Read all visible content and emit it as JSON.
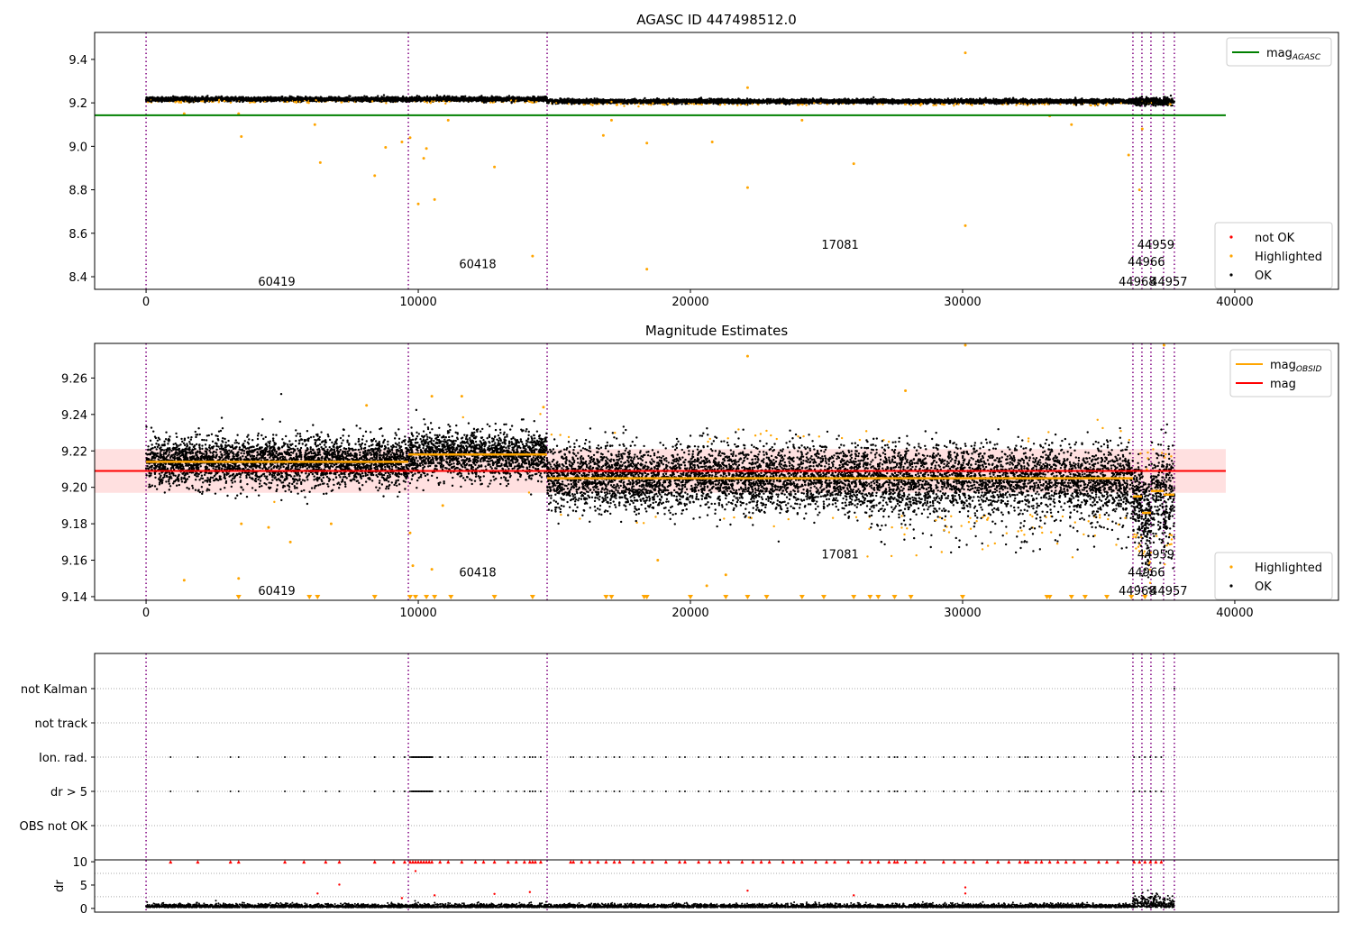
{
  "chart_data": [
    {
      "type": "scatter",
      "title": "AGASC ID 447498512.0",
      "xlim": [
        -1890,
        43810
      ],
      "ylim": [
        8.342,
        9.524
      ],
      "xticks": [
        0,
        10000,
        20000,
        30000,
        40000
      ],
      "yticks": [
        8.4,
        8.6,
        8.8,
        9.0,
        9.2,
        9.4
      ],
      "ytick_labels": [
        "8.4",
        "8.6",
        "8.8",
        "9.0",
        "9.2",
        "9.4"
      ],
      "legend_upper": {
        "placement": "upper right",
        "entries": [
          {
            "label": "mag",
            "subscript": "AGASC",
            "color": "#008000",
            "kind": "line"
          }
        ]
      },
      "legend_lower": {
        "placement": "lower right",
        "entries": [
          {
            "label": "not OK",
            "color": "#ff0000",
            "kind": "dot"
          },
          {
            "label": "Highlighted",
            "color": "#ffa500",
            "kind": "dot"
          },
          {
            "label": "OK",
            "color": "#000000",
            "kind": "dot"
          }
        ]
      },
      "mag_agasc": {
        "value": 9.143,
        "x_range": [
          0,
          39670
        ],
        "color": "#008000"
      },
      "ok_points_summary": {
        "level_before_14735": 9.217,
        "level_after_14735": 9.207,
        "spread": 0.008
      },
      "highlighted_points": [
        [
          3500,
          9.045
        ],
        [
          6200,
          9.1
        ],
        [
          6400,
          8.925
        ],
        [
          8400,
          8.865
        ],
        [
          8800,
          8.995
        ],
        [
          9400,
          9.02
        ],
        [
          9700,
          9.04
        ],
        [
          10000,
          8.735
        ],
        [
          10300,
          8.99
        ],
        [
          10600,
          8.755
        ],
        [
          10200,
          8.945
        ],
        [
          12800,
          8.905
        ],
        [
          14200,
          8.495
        ],
        [
          16800,
          9.05
        ],
        [
          18400,
          9.015
        ],
        [
          18400,
          8.435
        ],
        [
          20800,
          9.02
        ],
        [
          22100,
          8.81
        ],
        [
          22100,
          9.27
        ],
        [
          26000,
          8.92
        ],
        [
          30100,
          8.635
        ],
        [
          30100,
          9.43
        ],
        [
          36100,
          8.96
        ],
        [
          36500,
          8.8
        ],
        [
          1400,
          9.15
        ],
        [
          3400,
          9.15
        ],
        [
          11100,
          9.12
        ],
        [
          17100,
          9.12
        ],
        [
          24100,
          9.12
        ],
        [
          33200,
          9.14
        ],
        [
          34000,
          9.1
        ],
        [
          36600,
          9.08
        ]
      ],
      "obsid_labels": [
        {
          "text": "60419",
          "x": 4800,
          "y": 8.38
        },
        {
          "text": "60418",
          "x": 12185,
          "y": 8.46
        },
        {
          "text": "17081",
          "x": 25500,
          "y": 8.55
        },
        {
          "text": "44959",
          "x": 37100,
          "y": 8.55
        },
        {
          "text": "44966",
          "x": 36750,
          "y": 8.47
        },
        {
          "text": "44968",
          "x": 36420,
          "y": 8.38
        },
        {
          "text": "44957",
          "x": 37580,
          "y": 8.38
        }
      ]
    },
    {
      "type": "scatter",
      "title": "Magnitude Estimates",
      "xlim": [
        -1890,
        43810
      ],
      "ylim": [
        9.138,
        9.279
      ],
      "xticks": [
        0,
        10000,
        20000,
        30000,
        40000
      ],
      "yticks": [
        9.14,
        9.16,
        9.18,
        9.2,
        9.22,
        9.24,
        9.26
      ],
      "ytick_labels": [
        "9.14",
        "9.16",
        "9.18",
        "9.20",
        "9.22",
        "9.24",
        "9.26"
      ],
      "legend_upper": {
        "placement": "upper right",
        "entries": [
          {
            "label": "mag",
            "subscript": "OBSID",
            "color": "#ffa500",
            "kind": "line"
          },
          {
            "label": "mag",
            "subscript": "",
            "color": "#ff0000",
            "kind": "line"
          }
        ]
      },
      "legend_lower": {
        "placement": "lower right",
        "entries": [
          {
            "label": "Highlighted",
            "color": "#ffa500",
            "kind": "dot"
          },
          {
            "label": "OK",
            "color": "#000000",
            "kind": "dot"
          }
        ]
      },
      "mag": {
        "value": 9.209,
        "band": [
          9.197,
          9.221
        ],
        "x_range": [
          0,
          39670
        ],
        "color": "#ff0000"
      },
      "mag_obsid": [
        {
          "x0": 0,
          "x1": 9636,
          "y": 9.214,
          "sd": 0.009
        },
        {
          "x0": 9636,
          "x1": 14735,
          "y": 9.218,
          "sd": 0.009
        },
        {
          "x0": 14735,
          "x1": 36258,
          "y": 9.205,
          "sd": 0.012
        },
        {
          "x0": 36258,
          "x1": 36589,
          "y": 9.195,
          "sd": 0.014
        },
        {
          "x0": 36589,
          "x1": 36920,
          "y": 9.186,
          "sd": 0.016
        },
        {
          "x0": 36920,
          "x1": 37384,
          "y": 9.198,
          "sd": 0.016
        },
        {
          "x0": 37384,
          "x1": 37781,
          "y": 9.196,
          "sd": 0.018
        }
      ],
      "highlighted_points": [
        [
          1400,
          9.149
        ],
        [
          3400,
          9.15
        ],
        [
          3500,
          9.18
        ],
        [
          4500,
          9.178
        ],
        [
          5300,
          9.17
        ],
        [
          6800,
          9.18
        ],
        [
          9800,
          9.157
        ],
        [
          9700,
          9.175
        ],
        [
          10500,
          9.155
        ],
        [
          10900,
          9.19
        ],
        [
          18800,
          9.16
        ],
        [
          20600,
          9.146
        ],
        [
          21300,
          9.152
        ],
        [
          22100,
          9.272
        ],
        [
          27900,
          9.253
        ],
        [
          30100,
          9.278
        ],
        [
          37400,
          9.278
        ],
        [
          8100,
          9.245
        ],
        [
          10500,
          9.25
        ],
        [
          11600,
          9.25
        ],
        [
          14600,
          9.244
        ]
      ],
      "clipped_low_x": [
        3400,
        6000,
        6300,
        8400,
        9700,
        9900,
        10300,
        10600,
        11200,
        12800,
        14200,
        16900,
        17100,
        18300,
        18400,
        20000,
        21300,
        22100,
        22800,
        24100,
        24900,
        26000,
        26600,
        26900,
        27500,
        28100,
        30000,
        33100,
        33200,
        34000,
        34500,
        35300,
        36200,
        36700
      ],
      "obsid_labels": [
        {
          "text": "60419",
          "x": 4800,
          "y": 9.1435
        },
        {
          "text": "60418",
          "x": 12185,
          "y": 9.1535
        },
        {
          "text": "17081",
          "x": 25500,
          "y": 9.1635
        },
        {
          "text": "44959",
          "x": 37100,
          "y": 9.1635
        },
        {
          "text": "44966",
          "x": 36750,
          "y": 9.1535
        },
        {
          "text": "44968",
          "x": 36420,
          "y": 9.1435
        },
        {
          "text": "44957",
          "x": 37580,
          "y": 9.1435
        }
      ]
    },
    {
      "type": "scatter",
      "xlim": [
        -1890,
        43810
      ],
      "categories": [
        "not Kalman",
        "not track",
        "Ion. rad.",
        "dr > 5",
        "OBS not OK"
      ],
      "flag_times": [
        900,
        1900,
        3100,
        3400,
        5100,
        5800,
        6600,
        7100,
        8400,
        9100,
        9500,
        9700,
        9800,
        9900,
        10000,
        10100,
        10200,
        10300,
        10400,
        10500,
        10800,
        11100,
        11600,
        12100,
        12400,
        12800,
        13300,
        13600,
        13900,
        14100,
        14200,
        14300,
        14500,
        15600,
        15700,
        16000,
        16300,
        16600,
        16900,
        17200,
        17400,
        17900,
        18300,
        18600,
        19100,
        19600,
        19800,
        20300,
        20700,
        21100,
        21400,
        21900,
        22300,
        22600,
        22900,
        23400,
        23800,
        24100,
        24600,
        25000,
        25300,
        25800,
        26300,
        26600,
        26900,
        27300,
        27500,
        27600,
        27900,
        28300,
        28600,
        29300,
        29700,
        30100,
        30400,
        30900,
        31300,
        31700,
        32100,
        32300,
        32400,
        32700,
        32900,
        33200,
        33500,
        33800,
        34100,
        34500,
        35000,
        35300,
        35700,
        36300,
        36500,
        36700,
        36900,
        37100,
        37300
      ],
      "dr_panel": {
        "ylabel": "dr",
        "ylim": [
          -0.8,
          10.4
        ],
        "yticks": [
          0,
          5,
          10
        ],
        "clip_value": 10,
        "outliers": [
          [
            6300,
            3.2
          ],
          [
            7100,
            5.1
          ],
          [
            9900,
            8
          ],
          [
            10600,
            2.8
          ],
          [
            12800,
            3.1
          ],
          [
            14100,
            3.5
          ],
          [
            22100,
            3.8
          ],
          [
            26000,
            2.8
          ],
          [
            30100,
            4.5
          ],
          [
            30100,
            3.2
          ],
          [
            9400,
            2.2
          ]
        ]
      }
    }
  ],
  "obsid_boundaries": [
    0,
    9636,
    14735,
    36258,
    36589,
    36920,
    37384,
    37781
  ],
  "colors": {
    "boundary": "#800080",
    "ok": "#000000",
    "highlighted": "#ffa500",
    "not_ok": "#ff0000",
    "agasc": "#008000",
    "band": "#ffcccc"
  }
}
